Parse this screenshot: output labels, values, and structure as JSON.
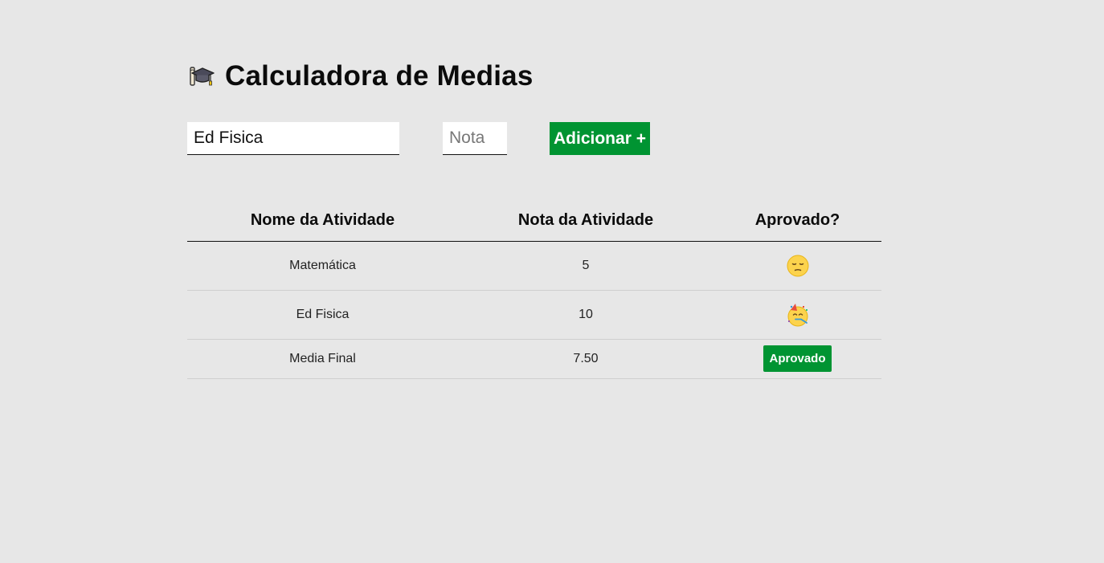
{
  "header": {
    "title": "Calculadora de Medias",
    "icon": "graduation-cap-icon"
  },
  "form": {
    "activity_value": "Ed Fisica",
    "activity_placeholder": "",
    "grade_value": "",
    "grade_placeholder": "Nota",
    "add_label": "Adicionar +"
  },
  "table": {
    "headers": [
      "Nome da Atividade",
      "Nota da Atividade",
      "Aprovado?"
    ],
    "rows": [
      {
        "name": "Matemática",
        "grade": "5",
        "status_icon": "sad-face-icon"
      },
      {
        "name": "Ed Fisica",
        "grade": "10",
        "status_icon": "party-face-icon"
      }
    ],
    "final": {
      "label": "Media Final",
      "value": "7.50",
      "result": "Aprovado"
    }
  },
  "colors": {
    "background": "#e7e7e7",
    "accent_green": "#009432"
  }
}
